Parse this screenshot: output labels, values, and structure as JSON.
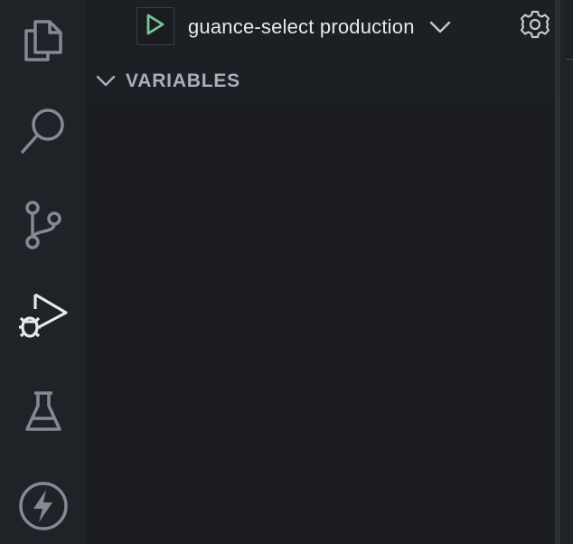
{
  "activity_bar": {
    "items": [
      {
        "name": "explorer",
        "icon": "files-icon",
        "active": false
      },
      {
        "name": "search",
        "icon": "search-icon",
        "active": false
      },
      {
        "name": "source-control",
        "icon": "source-control-icon",
        "active": false
      },
      {
        "name": "run-and-debug",
        "icon": "run-debug-icon",
        "active": true
      },
      {
        "name": "testing",
        "icon": "flask-icon",
        "active": false
      },
      {
        "name": "lightning",
        "icon": "lightning-icon",
        "active": false
      }
    ]
  },
  "debug_toolbar": {
    "run_icon": "play-icon",
    "launch_config": "guance-select production",
    "dropdown_icon": "chevron-down-icon",
    "settings_icon": "gear-icon"
  },
  "sections": {
    "variables": {
      "title": "VARIABLES",
      "expanded": true
    }
  },
  "colors": {
    "run_green": "#73c991",
    "icon_gray": "#858993",
    "icon_active": "#e6e8eb",
    "sidebar_bg": "#1a1c21",
    "activity_bg": "#1f2227"
  }
}
